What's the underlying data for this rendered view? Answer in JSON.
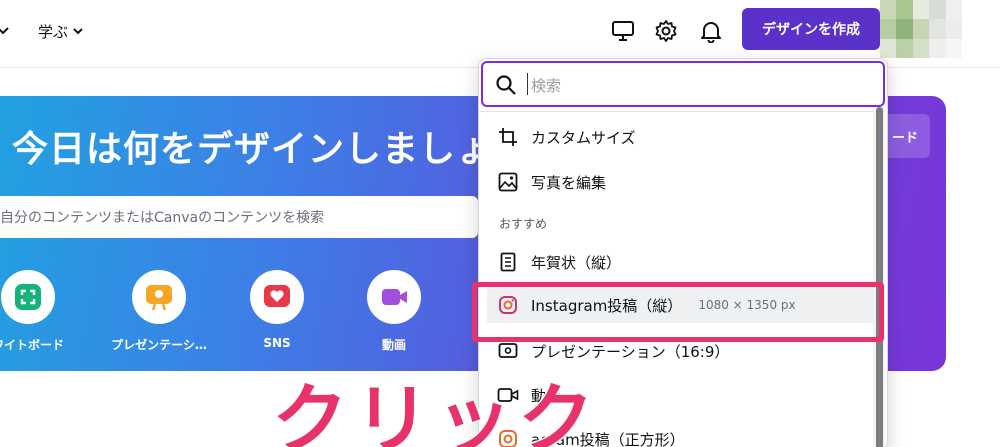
{
  "topbar": {
    "learn_label": "学ぶ",
    "create_button": "デザインを作成",
    "icons": [
      "desktop-icon",
      "gear-icon",
      "bell-icon"
    ]
  },
  "hero": {
    "title": "今日は何をデザインしましょ",
    "search_placeholder": "自分のコンテンツまたはCanvaのコンテンツを検索",
    "right_button": "ード",
    "categories": [
      {
        "label": "ワイトボード",
        "icon": "whiteboard-icon",
        "color": "#13b37a"
      },
      {
        "label": "プレゼンテーシ…",
        "icon": "presentation-icon",
        "color": "#f5a623"
      },
      {
        "label": "SNS",
        "icon": "heart-icon",
        "color": "#e8394b"
      },
      {
        "label": "動画",
        "icon": "video-icon",
        "color": "#a04fe0"
      }
    ]
  },
  "dropdown": {
    "search_placeholder": "検索",
    "items_top": [
      {
        "label": "カスタムサイズ",
        "icon": "custom-size-icon"
      },
      {
        "label": "写真を編集",
        "icon": "photo-edit-icon"
      }
    ],
    "section_label": "おすすめ",
    "items": [
      {
        "label": "年賀状（縦）",
        "sub": "",
        "icon": "card-icon"
      },
      {
        "label": "Instagram投稿（縦）",
        "sub": "1080 × 1350 px",
        "icon": "instagram-icon"
      },
      {
        "label": "プレゼンテーション（16:9）",
        "sub": "",
        "icon": "presentation-icon"
      },
      {
        "label": "動画",
        "sub": "",
        "icon": "video-icon"
      },
      {
        "label": "agram投稿（正方形）",
        "sub": "",
        "icon": "instagram-icon"
      }
    ]
  },
  "overlay": {
    "text": "クリック",
    "color": "#e8336a"
  },
  "colors": {
    "accent": "#5a32c9",
    "focus": "#7d2ae8",
    "highlight": "#e8336a"
  }
}
